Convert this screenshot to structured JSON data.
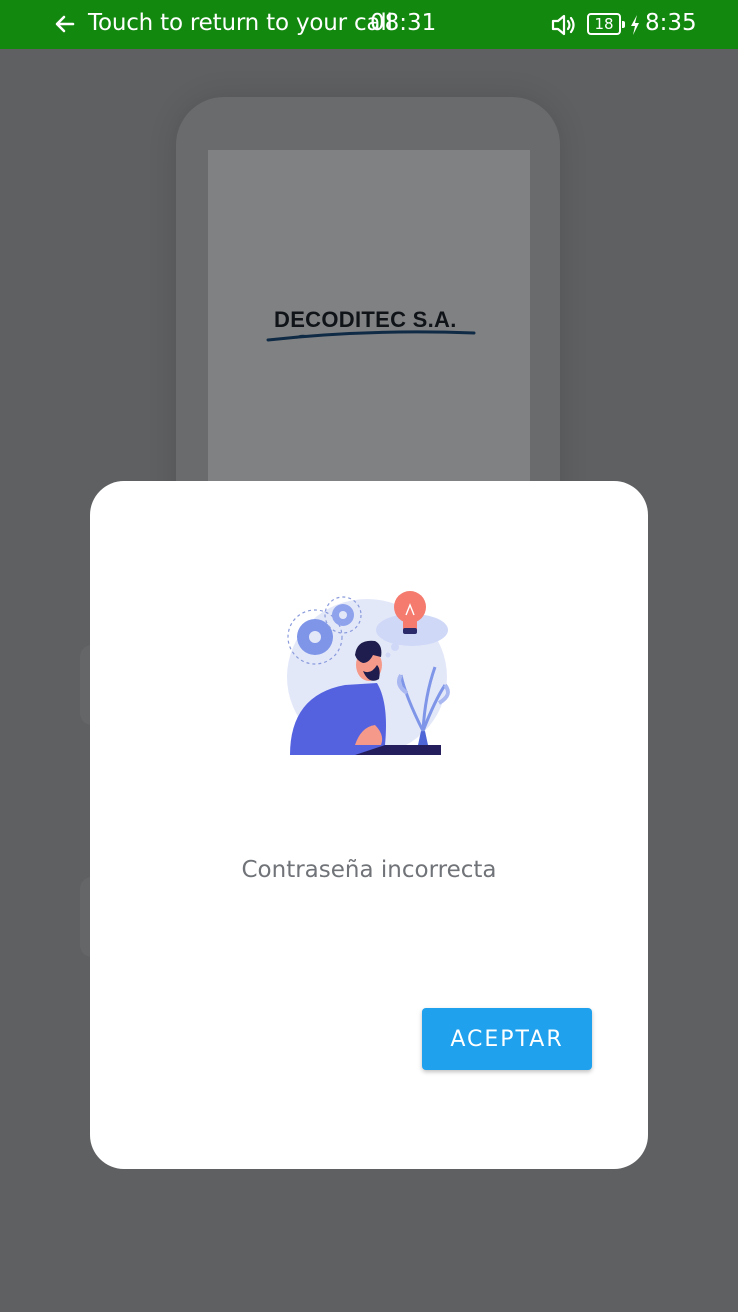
{
  "status_bar": {
    "call_text": "Touch to return to your call",
    "call_timer": "08:31",
    "battery_level": "18",
    "clock": "8:35",
    "background_color": "#12880f",
    "icons": [
      "back-arrow-icon",
      "volume-icon",
      "battery-icon",
      "charging-bolt-icon"
    ]
  },
  "background": {
    "logo_text": "DECODITEC S.A."
  },
  "dialog": {
    "illustration": "thinking-person-illustration",
    "message": "Contraseña incorrecta",
    "accept_label": "ACEPTAR",
    "accent_color": "#1fa1ed"
  }
}
